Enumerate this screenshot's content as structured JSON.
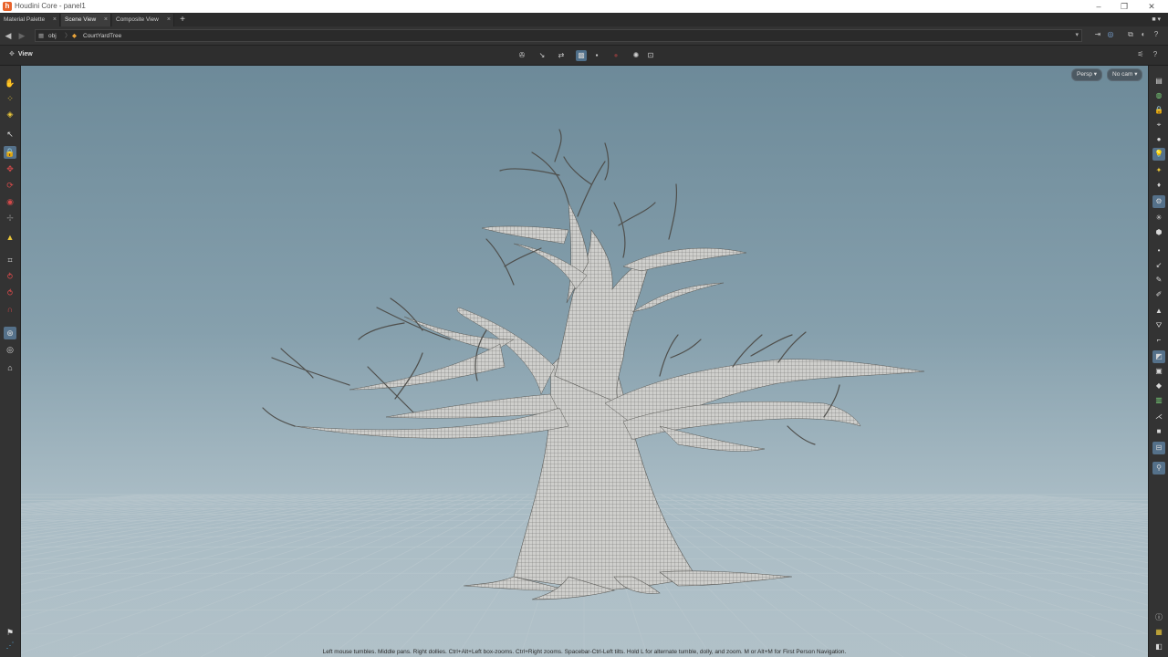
{
  "window": {
    "title": "Houdini Core - panel1",
    "app_icon": "houdini-icon",
    "controls": [
      "minimize-icon",
      "restore-icon",
      "close-icon"
    ]
  },
  "tabs": [
    {
      "label": "Material Palette",
      "active": false
    },
    {
      "label": "Scene View",
      "active": true
    },
    {
      "label": "Composite View",
      "active": false
    }
  ],
  "pathbar": {
    "segments": [
      "obj",
      "CourtYardTree"
    ]
  },
  "viewbar": {
    "label": "View"
  },
  "viewport": {
    "camera_menu": "Persp",
    "cam_menu": "No cam",
    "status_text": "Left mouse tumbles. Middle pans. Right dollies. Ctrl+Alt+Left box-zooms. Ctrl+Right zooms. Spacebar-Ctrl-Left tilts. Hold L for alternate tumble, dolly, and zoom.     M or Alt+M for First Person Navigation."
  },
  "colors": {
    "accent": "#55718a",
    "sky_top": "#6d8a99",
    "sky_bottom": "#b7c6cd",
    "tree": "#c9c9c5"
  }
}
